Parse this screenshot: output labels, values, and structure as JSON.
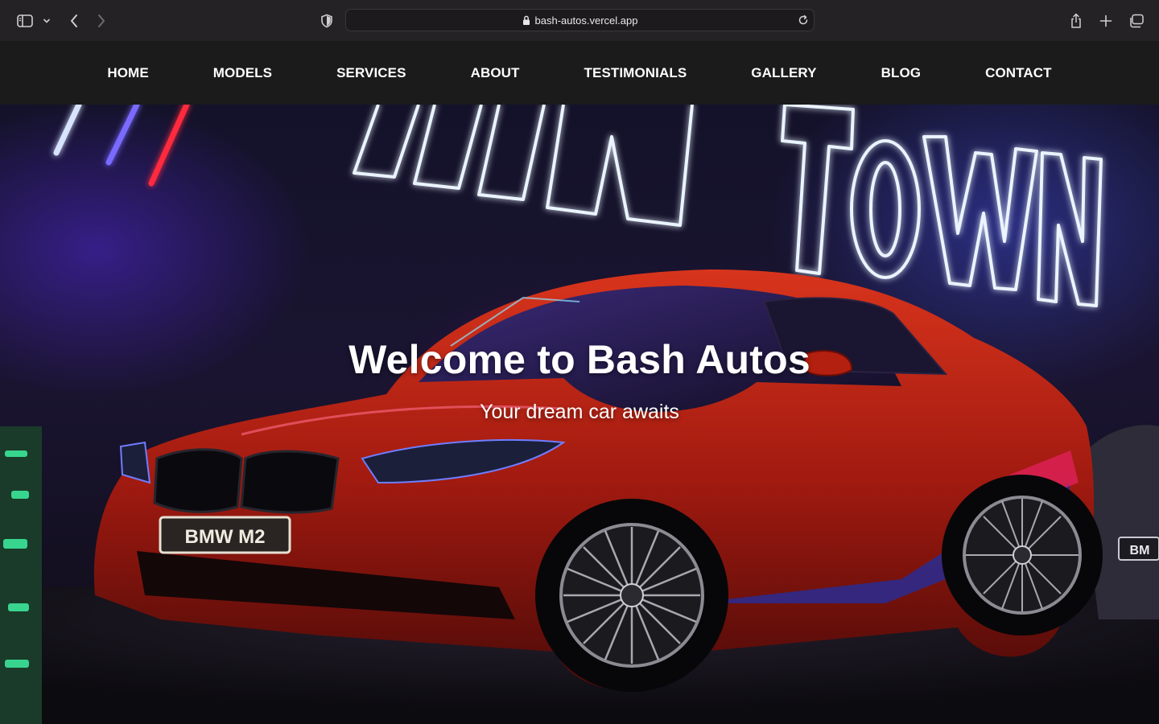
{
  "browser": {
    "url": "bash-autos.vercel.app",
    "icons": [
      "sidebar-icon",
      "chevron-down-icon",
      "back-icon",
      "forward-icon",
      "shield-icon",
      "lock-icon",
      "reload-icon",
      "share-icon",
      "plus-icon",
      "tabs-icon"
    ]
  },
  "nav": {
    "items": [
      {
        "label": "HOME"
      },
      {
        "label": "MODELS"
      },
      {
        "label": "SERVICES"
      },
      {
        "label": "ABOUT"
      },
      {
        "label": "TESTIMONIALS"
      },
      {
        "label": "GALLERY"
      },
      {
        "label": "BLOG"
      },
      {
        "label": "CONTACT"
      }
    ]
  },
  "hero": {
    "title": "Welcome to Bash Autos",
    "subtitle": "Your dream car awaits",
    "plate": "BMW M2",
    "plate_right": "BM",
    "neon_sign": "TOWN"
  },
  "colors": {
    "nav_bg": "#1b1b1b",
    "chrome_bg": "#242224",
    "car_body": "#b3200f",
    "neon": "#e9f3ff"
  }
}
